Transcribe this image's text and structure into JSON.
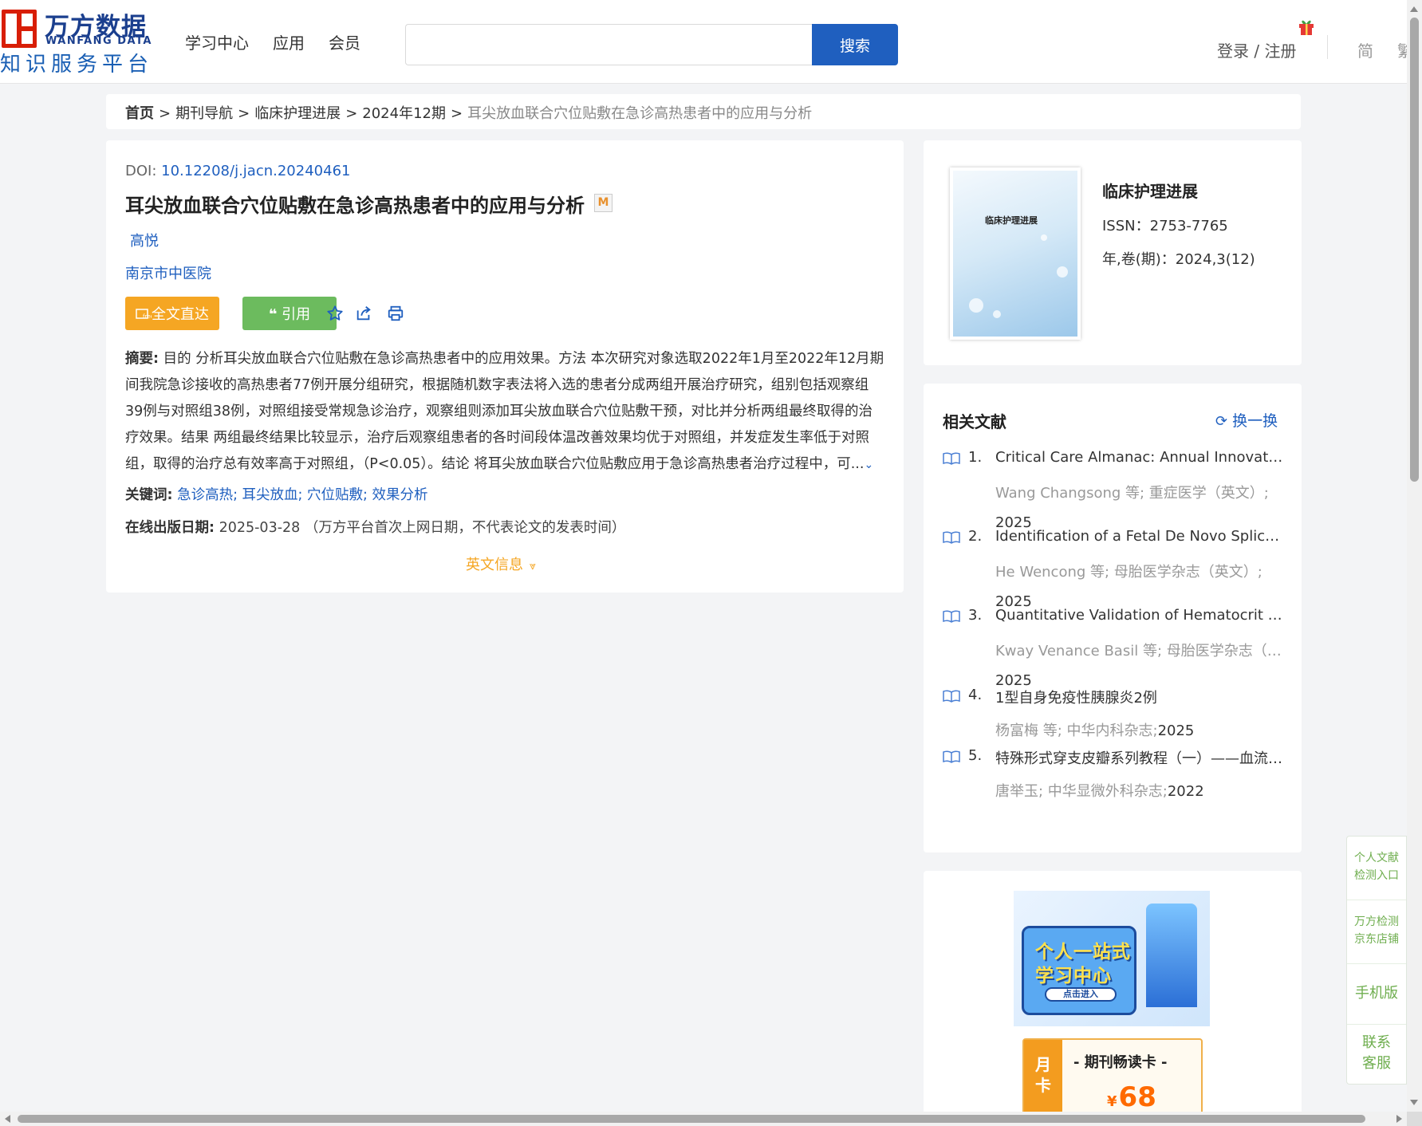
{
  "header": {
    "logo": {
      "brand_cn": "万方数据",
      "brand_en": "WANFANG DATA",
      "slogan": "知识服务平台"
    },
    "nav": [
      "学习中心",
      "应用",
      "会员"
    ],
    "search": {
      "placeholder": "",
      "button_label": "搜索"
    },
    "login_label": "登录 / 注册",
    "lang_simplified": "简",
    "lang_traditional": "繁"
  },
  "breadcrumb": {
    "home": "首页",
    "items": [
      "期刊导航",
      "临床护理进展",
      "2024年12期"
    ],
    "separator": ">",
    "current": "耳尖放血联合穴位贴敷在急诊高热患者中的应用与分析"
  },
  "article": {
    "doi_label": "DOI: ",
    "doi_value": "10.12208/j.jacn.20240461",
    "title": "耳尖放血联合穴位贴敷在急诊高热患者中的应用与分析",
    "m_badge": "M",
    "author": "高悦",
    "organization": "南京市中医院",
    "fulltext_button": "全文直达",
    "cite_button": "引用",
    "abstract_label": "摘要:",
    "abstract_text": " 目的 分析耳尖放血联合穴位贴敷在急诊高热患者中的应用效果。方法 本次研究对象选取2022年1月至2022年12月期间我院急诊接收的高热患者77例开展分组研究，根据随机数字表法将入选的患者分成两组开展治疗研究，组别包括观察组39例与对照组38例，对照组接受常规急诊治疗，观察组则添加耳尖放血联合穴位贴敷干预，对比并分析两组最终取得的治疗效果。结果 两组最终结果比较显示，治疗后观察组患者的各时间段体温改善效果均优于对照组，并发症发生率低于对照组，取得的治疗总有效率高于对照组，（P<0.05）。结论 将耳尖放血联合穴位贴敷应用于急诊高热患者治疗过程中，可...",
    "keywords_label": "关键词:",
    "keywords": [
      "急诊高热",
      "耳尖放血",
      "穴位贴敷",
      "效果分析"
    ],
    "pubdate_label": "在线出版日期:",
    "pubdate_value": "2025-03-28",
    "pubdate_note": "（万方平台首次上网日期，不代表论文的发表时间）",
    "english_info_toggle": "英文信息"
  },
  "journal": {
    "cover_title": "临床护理进展",
    "name": "临床护理进展",
    "issn": "ISSN：2753-7765",
    "issue": "年,卷(期)：2024,3(12)"
  },
  "related": {
    "title": "相关文献",
    "refresh_label": "换一换",
    "items": [
      {
        "num": "1.",
        "title": "Critical Care Almanac: Annual Innovation Review",
        "meta": "Wang Changsong  等;  重症医学（英文）;",
        "year": "2025"
      },
      {
        "num": "2.",
        "title": "Identification of a Fetal De Novo Splice Variant",
        "meta": "He Wencong  等;  母胎医学杂志（英文）;",
        "year": "2025"
      },
      {
        "num": "3.",
        "title": "Quantitative Validation of Hematocrit Performance",
        "meta": "Kway Venance Basil  等;  母胎医学杂志（英文）;",
        "year": "2025"
      },
      {
        "num": "4.",
        "title": "1型自身免疫性胰腺炎2例",
        "meta": "杨富梅  等;  中华内科杂志;",
        "year": "2025"
      },
      {
        "num": "5.",
        "title": "特殊形式穿支皮瓣系列教程（一）——血流桥接",
        "meta": "唐举玉; 中华显微外科杂志;",
        "year": "2022"
      }
    ]
  },
  "promo": {
    "banner_line1": "个人一站式",
    "banner_line2": "学习中心",
    "banner_enter": "点击进入",
    "card_tag": [
      "月",
      "卡"
    ],
    "card_name": "- 期刊畅读卡 -",
    "card_currency": "¥",
    "card_price": "68"
  },
  "side_toolbar": {
    "items": [
      {
        "lines": [
          "个人文献",
          "检测入口"
        ]
      },
      {
        "lines": [
          "万方检测",
          "京东店铺"
        ]
      },
      {
        "lines": [
          "手机版"
        ]
      },
      {
        "lines": [
          "联系",
          "客服"
        ]
      }
    ]
  },
  "colors": {
    "primary_blue": "#1f5fbf",
    "orange": "#f5a623",
    "green": "#6cbb5e",
    "brand_red": "#d81e06"
  }
}
